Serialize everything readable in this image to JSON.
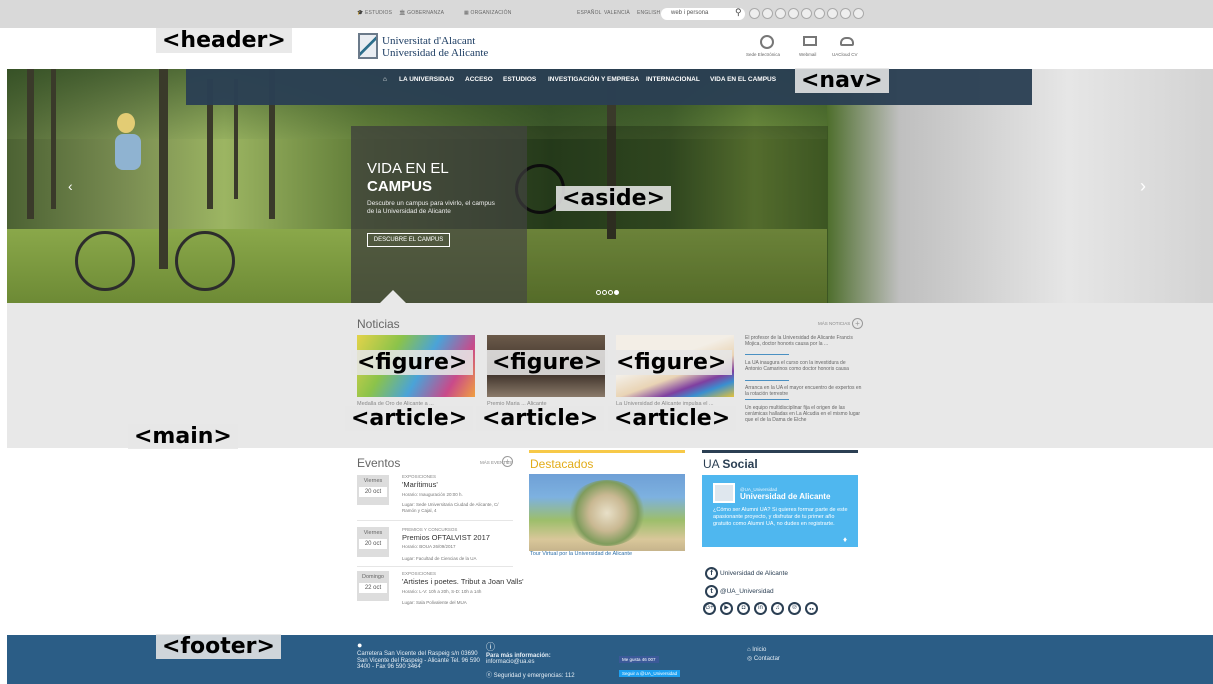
{
  "topbar": {
    "links": [
      "ESTUDIOS",
      "GOBERNANZA",
      "ORGANIZACIÓN"
    ],
    "languages": [
      "ESPAÑOL",
      "VALENCIÀ",
      "ENGLISH"
    ],
    "search_value": "web i persona",
    "social_icons": [
      "facebook-icon",
      "twitter-icon",
      "googleplus-icon",
      "youtube-icon",
      "instagram-icon",
      "linkedin-icon",
      "itunes-icon",
      "pinterest-icon",
      "flickr-icon"
    ]
  },
  "header": {
    "logo_line1": "Universitat d'Alacant",
    "logo_line2": "Universidad de Alicante",
    "icons": [
      "Sede Electrónica",
      "Webmail",
      "UACloud CV"
    ]
  },
  "nav": {
    "items": [
      "LA UNIVERSIDAD",
      "ACCESO",
      "ESTUDIOS",
      "INVESTIGACIÓN Y EMPRESA",
      "INTERNACIONAL",
      "VIDA EN EL CAMPUS"
    ]
  },
  "hero": {
    "title_line1": "VIDA EN EL",
    "title_line2": "CAMPUS",
    "description": "Descubre un campus para vivirlo, el campus de la Universidad de Alicante",
    "button": "DESCUBRE EL CAMPUS",
    "slides": 4,
    "active_slide": 4
  },
  "news": {
    "title": "Noticias",
    "more": "MÁS NOTICIAS",
    "captions": [
      "Medalla de Oro de Alicante a ...",
      "Premio Maria ... Alicante",
      "La Universidad de Alicante impulsa el ..."
    ],
    "side": [
      "El profesor de la Universidad de Alicante Francis Mojica, doctor honoris causa por la ...",
      "La UA inaugura el curso con la investidura de Antonio Camarinos como doctor honoris causa",
      "Arranca en la UA el mayor encuentro de expertos en la rotación terrestre",
      "Un equipo multidisciplinar fija el origen de las cerámicas halladas en La Alcudia en el mismo lugar que el de la Dama de Elche"
    ]
  },
  "events": {
    "title": "Eventos",
    "more": "MÁS EVENTOS",
    "items": [
      {
        "day": "Viernes",
        "date": "20 oct",
        "category": "EXPOSICIONES",
        "title": "'Marítimus'",
        "info1": "Horario: Inauguración 20:00 h.",
        "info2": "Lugar: Sede Universitaria Ciudad de Alicante, C/ Ramón y Cajal, 4"
      },
      {
        "day": "Viernes",
        "date": "20 oct",
        "category": "PREMIOS Y CONCURSOS",
        "title": "Premios OFTALVIST 2017",
        "info1": "Horario: BOUA 26/09/2017",
        "info2": "Lugar: Facultad de Ciencias de la UA"
      },
      {
        "day": "Domingo",
        "date": "22 oct",
        "category": "EXPOSICIONES",
        "title": "'Artistes i poetes. Tribut a Joan Valls'",
        "info1": "Horario: L-V: 10h a 20h, S-D: 10h a 14h",
        "info2": "Lugar: Sala Polivalente del MUA"
      }
    ]
  },
  "featured": {
    "title": "Destacados",
    "caption": "Tour Virtual por la Universidad de Alicante"
  },
  "social": {
    "title_prefix": "UA ",
    "title_bold": "Social",
    "handle": "@UA_Universidad",
    "card_name": "Universidad de Alicante",
    "card_text": "¿Cómo ser Alumni UA? Si quieres formar parte de este apasionante proyecto, y disfrutar de tu primer año gratuito como Alumni UA, no dudes en registrarte.",
    "facebook": "Universidad de Alicante",
    "twitter": "@UA_Universidad",
    "icons": [
      "G+",
      "▶",
      "◘",
      "in",
      "♫",
      "℗",
      "●●"
    ]
  },
  "footer": {
    "address": "Carretera San Vicente del Raspeig s/n 03690 San Vicente del Raspeig - Alicante Tel. 96 590 3400 - Fax 96 590 3464",
    "info_title": "Para más información:",
    "info_email": "informacio@ua.es",
    "security": "Seguridad y emergencias: 112",
    "fb_btn": "Me gusta 46 007",
    "tw_btn": "Seguir a @UA_Universidad",
    "links": [
      "Inicio",
      "Contactar"
    ]
  },
  "overlay_tags": [
    "<header>",
    "<nav>",
    "<aside>",
    "<figure>",
    "<figure>",
    "<figure>",
    "<article>",
    "<article>",
    "<article>",
    "<main>",
    "<footer>"
  ],
  "colors": {
    "nav_bg": "#2b3f53",
    "footer_bg": "#2b5d86",
    "accent_yellow": "#f7c948",
    "social_blue": "#4fb7ef"
  }
}
